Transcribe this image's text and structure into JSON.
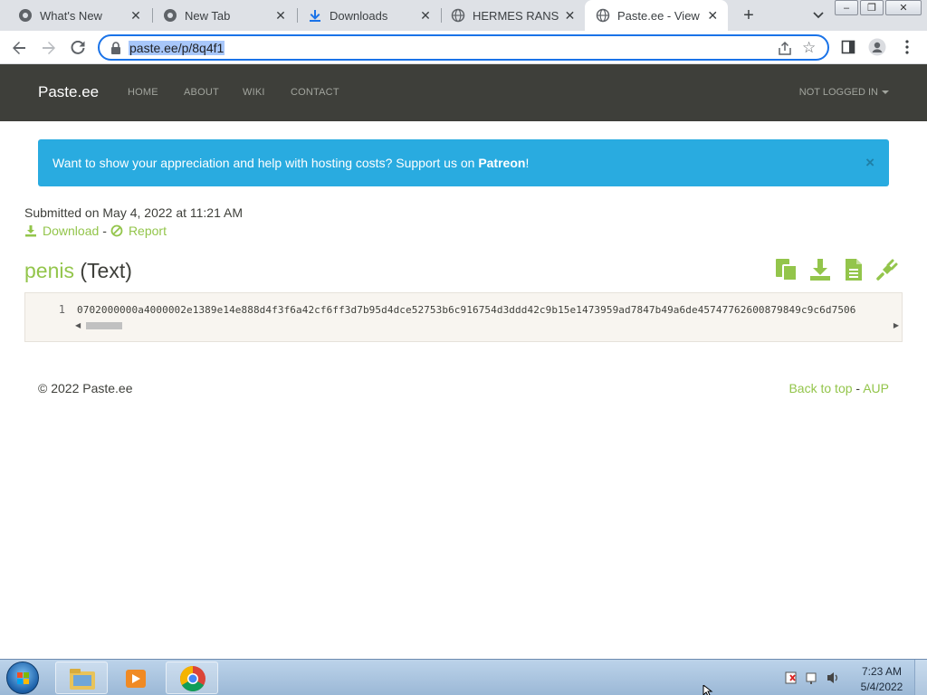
{
  "browser": {
    "tabs": [
      {
        "title": "What's New",
        "icon": "chrome-icon",
        "active": false
      },
      {
        "title": "New Tab",
        "icon": "chrome-icon",
        "active": false
      },
      {
        "title": "Downloads",
        "icon": "download-icon",
        "active": false
      },
      {
        "title": "HERMES RANSOM",
        "icon": "globe-icon",
        "active": false
      },
      {
        "title": "Paste.ee - View pa",
        "icon": "globe-icon",
        "active": true
      }
    ],
    "url": "paste.ee/p/8q4f1"
  },
  "site": {
    "brand": "Paste.ee",
    "nav": [
      "HOME",
      "ABOUT",
      "WIKI",
      "CONTACT"
    ],
    "user_menu": "NOT LOGGED IN"
  },
  "alert": {
    "text": "Want to show your appreciation and help with hosting costs? Support us on ",
    "strong": "Patreon",
    "end": "!",
    "close": "×"
  },
  "paste": {
    "submitted": "Submitted on May 4, 2022 at 11:21 AM",
    "download_label": "Download",
    "report_label": "Report",
    "separator": "-",
    "name": "penis",
    "language": "(Text)",
    "line_number": "1",
    "code": "0702000000a4000002e1389e14e888d4f3f6a42cf6ff3d7b95d4dce52753b6c916754d3ddd42c9b15e1473959ad7847b49a6de45747762600879849c9c6d7506"
  },
  "footer": {
    "copyright": "© 2022 Paste.ee",
    "back_to_top": "Back to top",
    "separator": "-",
    "aup": "AUP"
  },
  "taskbar": {
    "time": "7:23 AM",
    "date": "5/4/2022"
  },
  "colors": {
    "navbar": "#3e3f3a",
    "accent_green": "#93c54b",
    "alert_blue": "#29abe0",
    "code_bg": "#f8f5f0"
  }
}
